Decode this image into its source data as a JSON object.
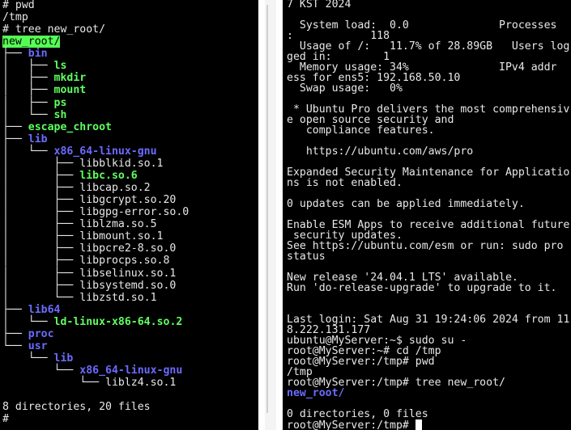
{
  "left_terminal": {
    "lines": [
      {
        "text": "# pwd"
      },
      {
        "text": "/tmp"
      },
      {
        "text": "# tree new_root/"
      },
      {
        "text": "",
        "hl": "new_root/"
      },
      {
        "text": "├── ",
        "hl": "bin",
        "cls": "c-blue"
      },
      {
        "text": "│   ├── ",
        "hl": "ls",
        "cls": "c-green"
      },
      {
        "text": "│   ├── ",
        "hl": "mkdir",
        "cls": "c-green"
      },
      {
        "text": "│   ├── ",
        "hl": "mount",
        "cls": "c-green"
      },
      {
        "text": "│   ├── ",
        "hl": "ps",
        "cls": "c-green"
      },
      {
        "text": "│   └── ",
        "hl": "sh",
        "cls": "c-green"
      },
      {
        "text": "├── ",
        "hl": "escape_chroot",
        "cls": "c-green"
      },
      {
        "text": "├── ",
        "hl": "lib",
        "cls": "c-blue"
      },
      {
        "text": "│   └── ",
        "hl": "x86_64-linux-gnu",
        "cls": "c-blue"
      },
      {
        "text": "│       ├── libblkid.so.1"
      },
      {
        "text": "│       ├── ",
        "hl": "libc.so.6",
        "cls": "c-green"
      },
      {
        "text": "│       ├── libcap.so.2"
      },
      {
        "text": "│       ├── libgcrypt.so.20"
      },
      {
        "text": "│       ├── libgpg-error.so.0"
      },
      {
        "text": "│       ├── liblzma.so.5"
      },
      {
        "text": "│       ├── libmount.so.1"
      },
      {
        "text": "│       ├── libpcre2-8.so.0"
      },
      {
        "text": "│       ├── libprocps.so.8"
      },
      {
        "text": "│       ├── libselinux.so.1"
      },
      {
        "text": "│       ├── libsystemd.so.0"
      },
      {
        "text": "│       └── libzstd.so.1"
      },
      {
        "text": "├── ",
        "hl": "lib64",
        "cls": "c-blue"
      },
      {
        "text": "│   └── ",
        "hl": "ld-linux-x86-64.so.2",
        "cls": "c-green"
      },
      {
        "text": "├── ",
        "hl": "proc",
        "cls": "c-blue"
      },
      {
        "text": "└── ",
        "hl": "usr",
        "cls": "c-blue"
      },
      {
        "text": "    └── ",
        "hl": "lib",
        "cls": "c-blue"
      },
      {
        "text": "        └── ",
        "hl": "x86_64-linux-gnu",
        "cls": "c-blue"
      },
      {
        "text": "            └── liblz4.so.1"
      },
      {
        "text": ""
      },
      {
        "text": "8 directories, 20 files"
      },
      {
        "text": "#"
      }
    ]
  },
  "right_terminal": {
    "lines": [
      {
        "text": "7 KST 2024"
      },
      {
        "text": ""
      },
      {
        "text": "  System load:  0.0              Processes"
      },
      {
        "text": ":            118"
      },
      {
        "text": "  Usage of /:   11.7% of 28.89GB   Users log"
      },
      {
        "text": "ged in:        1"
      },
      {
        "text": "  Memory usage: 34%              IPv4 addr"
      },
      {
        "text": "ess for ens5: 192.168.50.10"
      },
      {
        "text": "  Swap usage:   0%"
      },
      {
        "text": ""
      },
      {
        "text": " * Ubuntu Pro delivers the most comprehensiv"
      },
      {
        "text": "e open source security and"
      },
      {
        "text": "   compliance features."
      },
      {
        "text": ""
      },
      {
        "text": "   https://ubuntu.com/aws/pro"
      },
      {
        "text": ""
      },
      {
        "text": "Expanded Security Maintenance for Applicatio"
      },
      {
        "text": "ns is not enabled."
      },
      {
        "text": ""
      },
      {
        "text": "0 updates can be applied immediately."
      },
      {
        "text": ""
      },
      {
        "text": "Enable ESM Apps to receive additional future"
      },
      {
        "text": " security updates."
      },
      {
        "text": "See https://ubuntu.com/esm or run: sudo pro"
      },
      {
        "text": "status"
      },
      {
        "text": ""
      },
      {
        "text": "New release '24.04.1 LTS' available."
      },
      {
        "text": "Run 'do-release-upgrade' to upgrade to it."
      },
      {
        "text": ""
      },
      {
        "text": ""
      },
      {
        "text": "Last login: Sat Aug 31 19:24:06 2024 from 11"
      },
      {
        "text": "8.222.131.177"
      },
      {
        "text": "ubuntu@MyServer:~$ sudo su -"
      },
      {
        "text": "root@MyServer:~# cd /tmp"
      },
      {
        "text": "root@MyServer:/tmp# pwd"
      },
      {
        "text": "/tmp"
      },
      {
        "text": "root@MyServer:/tmp# tree new_root/"
      },
      {
        "text": "",
        "hl": "new_root/",
        "cls": "c-blue"
      },
      {
        "text": ""
      },
      {
        "text": "0 directories, 0 files"
      },
      {
        "text": "root@MyServer:/tmp# ",
        "cursor": true
      }
    ]
  },
  "colors": {
    "background": "#000000",
    "text": "#e8e8e8",
    "directory": "#6b6bff",
    "executable": "#5fff5f",
    "highlight_bg": "#55ff55"
  }
}
